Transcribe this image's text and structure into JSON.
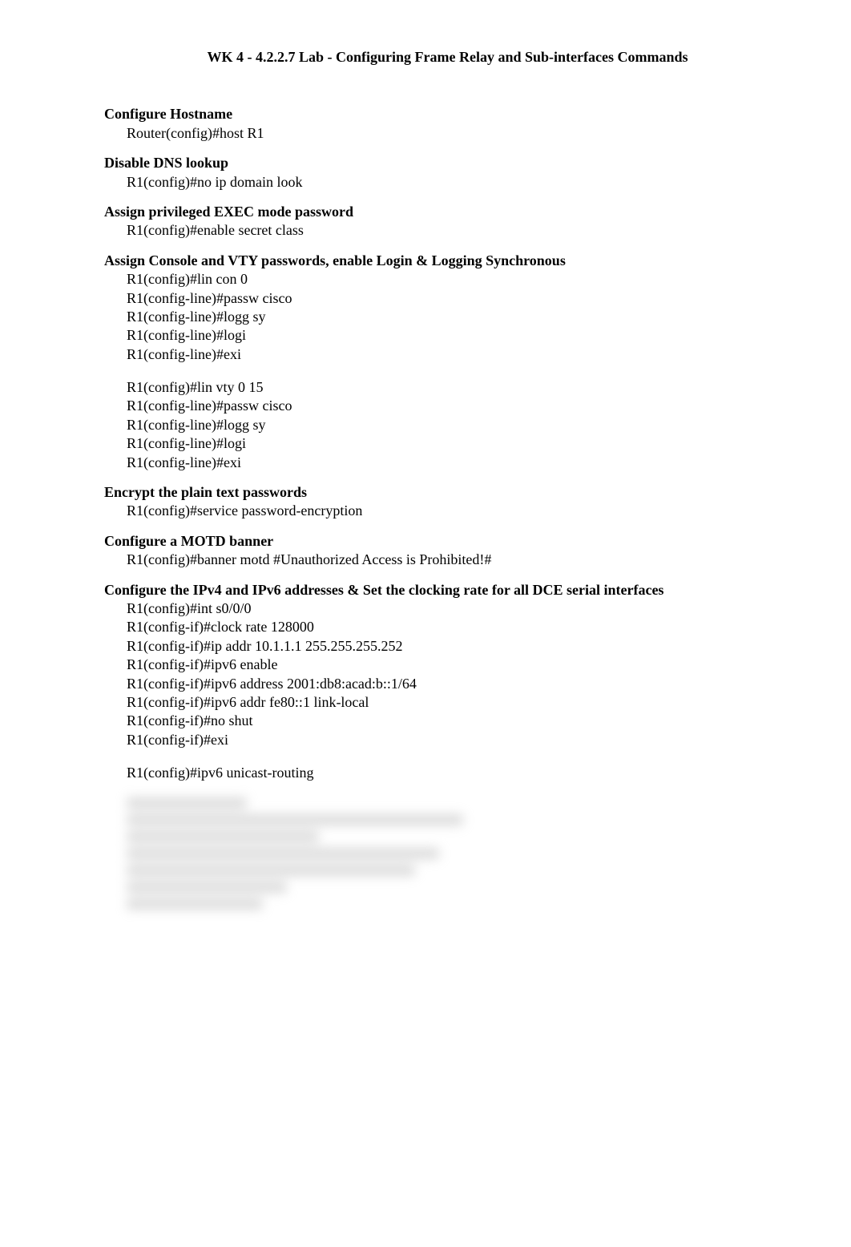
{
  "title": "WK 4 - 4.2.2.7 Lab - Configuring Frame Relay and Sub-interfaces Commands",
  "sections": [
    {
      "heading": "Configure Hostname",
      "blocks": [
        [
          "Router(config)#host R1"
        ]
      ]
    },
    {
      "heading": "Disable DNS lookup",
      "blocks": [
        [
          "R1(config)#no ip domain look"
        ]
      ]
    },
    {
      "heading": "Assign privileged EXEC mode password",
      "blocks": [
        [
          "R1(config)#enable secret class"
        ]
      ]
    },
    {
      "heading": "Assign Console and VTY passwords, enable Login & Logging Synchronous",
      "blocks": [
        [
          "R1(config)#lin con 0",
          "R1(config-line)#passw cisco",
          "R1(config-line)#logg sy",
          "R1(config-line)#logi",
          "R1(config-line)#exi"
        ],
        [
          "R1(config)#lin vty 0 15",
          "R1(config-line)#passw cisco",
          "R1(config-line)#logg sy",
          "R1(config-line)#logi",
          "R1(config-line)#exi"
        ]
      ]
    },
    {
      "heading": "Encrypt the plain text passwords",
      "blocks": [
        [
          "R1(config)#service password-encryption"
        ]
      ]
    },
    {
      "heading": "Configure a MOTD banner",
      "blocks": [
        [
          "R1(config)#banner motd #Unauthorized Access is Prohibited!#"
        ]
      ]
    },
    {
      "heading": "Configure the IPv4 and IPv6 addresses & Set the clocking rate for all DCE serial interfaces",
      "blocks": [
        [
          "R1(config)#int s0/0/0",
          "R1(config-if)#clock rate 128000",
          "R1(config-if)#ip addr 10.1.1.1 255.255.255.252",
          "R1(config-if)#ipv6 enable",
          "R1(config-if)#ipv6 address 2001:db8:acad:b::1/64",
          "R1(config-if)#ipv6 addr fe80::1 link-local",
          "R1(config-if)#no shut",
          "R1(config-if)#exi"
        ],
        [
          "R1(config)#ipv6 unicast-routing"
        ]
      ]
    }
  ]
}
